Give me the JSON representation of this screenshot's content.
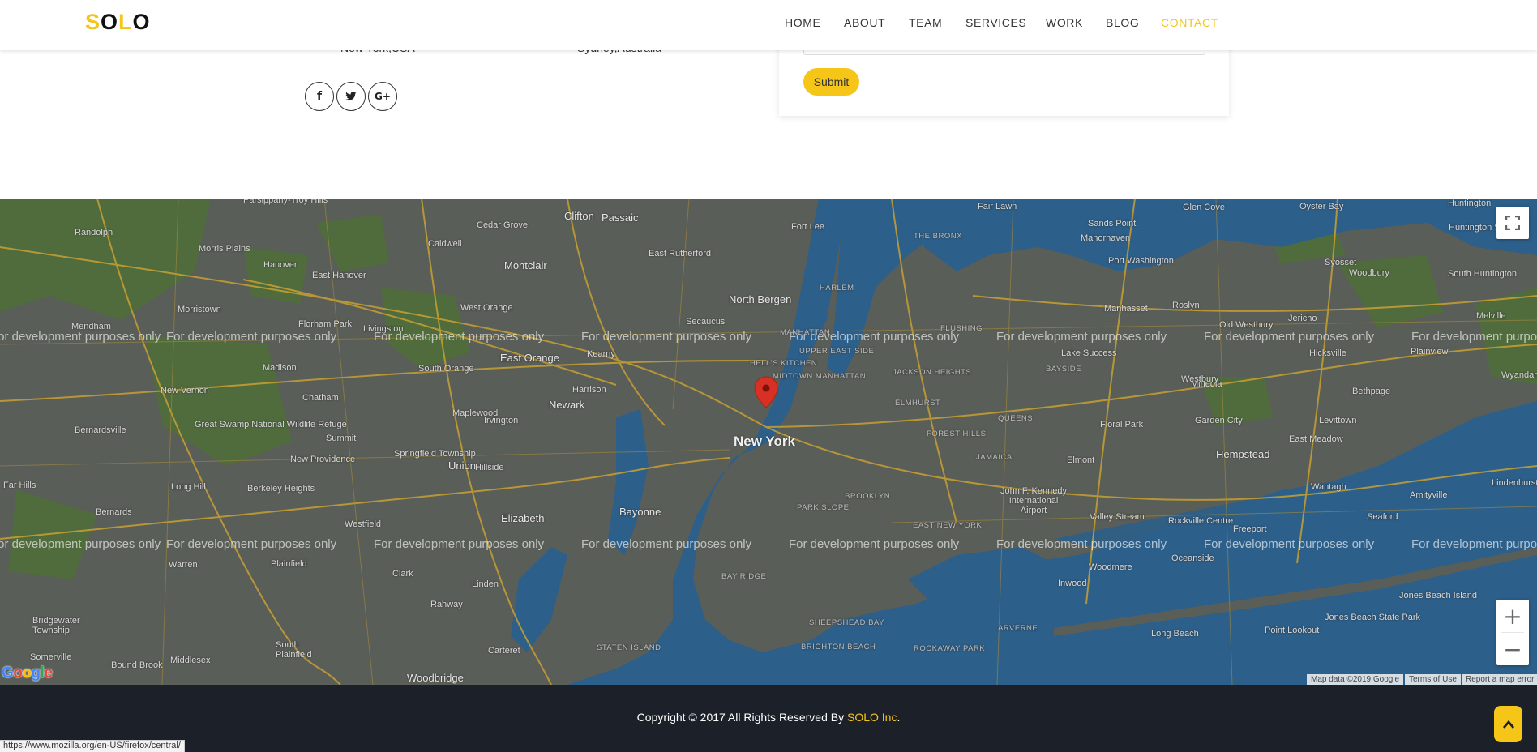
{
  "header": {
    "logo": {
      "first_letter": "S",
      "middle": "O",
      "third": "L",
      "last": "O"
    },
    "nav": [
      {
        "label": "HOME",
        "active": false
      },
      {
        "label": "ABOUT",
        "active": false
      },
      {
        "label": "TEAM",
        "active": false
      },
      {
        "label": "SERVICES",
        "active": false
      },
      {
        "label": "WORK",
        "active": false
      },
      {
        "label": "BLOG",
        "active": false
      },
      {
        "label": "CONTACT",
        "active": true
      }
    ]
  },
  "contact": {
    "address_1": "New York,USA",
    "address_2": "Sydney,Australia",
    "social_icons": [
      "facebook-icon",
      "twitter-icon",
      "google-plus-icon"
    ],
    "submit_label": "Submit"
  },
  "map": {
    "watermark": "For development purposes only",
    "marker_label": "New York",
    "places": [
      "Clifton",
      "Passaic",
      "Montclair",
      "East Rutherford",
      "North Bergen",
      "Secaucus",
      "East Orange",
      "Newark",
      "Harrison",
      "Kearny",
      "Irvington",
      "Maplewood",
      "South Orange",
      "Union",
      "Hillside",
      "Elizabeth",
      "Bayonne",
      "Linden",
      "Rahway",
      "Carteret",
      "Woodbridge",
      "Clark",
      "Plainfield",
      "Westfield",
      "Warren",
      "Bernards",
      "Long Hill",
      "Berkeley Heights",
      "New Providence",
      "Summit",
      "Springfield Township",
      "Chatham",
      "Madison",
      "Morristown",
      "Randolph",
      "Mendham",
      "Great Swamp National Wildlife Refuge",
      "Bernardsville",
      "New Vernon",
      "Far Hills",
      "Fort Lee",
      "THE BRONX",
      "HARLEM",
      "MANHATTAN",
      "MIDTOWN MANHATTAN",
      "HELL'S KITCHEN",
      "UPPER EAST SIDE",
      "JACKSON HEIGHTS",
      "ELMHURST",
      "FOREST HILLS",
      "QUEENS",
      "JAMAICA",
      "BROOKLYN",
      "PARK SLOPE",
      "BAY RIDGE",
      "EAST NEW YORK",
      "FLUSHING",
      "BAYSIDE",
      "Floral Park",
      "Elmont",
      "Valley Stream",
      "Hempstead",
      "Garden City",
      "Mineola",
      "Levittown",
      "East Meadow",
      "Wantagh",
      "Seaford",
      "Freeport",
      "Rockville Centre",
      "Oceanside",
      "Woodmere",
      "Inwood",
      "Long Beach",
      "Point Lookout",
      "Jones Beach Island",
      "Jones Beach State Park",
      "Westbury",
      "Hicksville",
      "Plainview",
      "Old Westbury",
      "Jericho",
      "Lake Success",
      "Manhasset",
      "Roslyn",
      "Port Washington",
      "Sands Point",
      "Manorhaven",
      "Glen Cove",
      "Oyster Bay",
      "Syosset",
      "Woodbury",
      "Huntington",
      "Huntington Station",
      "South Huntington",
      "Melville",
      "Bethpage",
      "Amityville",
      "Lindenhurst",
      "Wyandanch",
      "John F. Kennedy International Airport",
      "STATEN ISLAND",
      "SHEEPSHEAD BAY",
      "BRIGHTON BEACH",
      "ROCKAWAY PARK",
      "ARVERNE",
      "Somerville",
      "Bridgewater Township",
      "Bound Brook",
      "Middlesex",
      "South Plainfield",
      "Cedar Grove",
      "Caldwell",
      "West Orange",
      "Livingston",
      "Florham Park",
      "East Hanover",
      "Hanover",
      "Morris Plains",
      "Parsippany-Troy Hills",
      "Fair Lawn"
    ],
    "fullscreen_icon": "fullscreen-icon",
    "zoom_in": "+",
    "zoom_out": "−",
    "attribution": {
      "data": "Map data ©2019 Google",
      "terms": "Terms of Use",
      "report": "Report a map error"
    },
    "google_logo": "Google"
  },
  "footer": {
    "copyright_prefix": "Copyright © 2017 All Rights Reserved By ",
    "brand": "SOLO Inc",
    "suffix": ".",
    "to_top_icon": "chevron-up-icon"
  },
  "status_bar": {
    "url": "https://www.mozilla.org/en-US/firefox/central/"
  },
  "colors": {
    "accent": "#f5c518",
    "footer_bg": "#1c2029",
    "water": "#2c5f8a",
    "land": "#5a5e58",
    "park": "#4f6e3b",
    "road": "#c8a033",
    "marker": "#d93025"
  }
}
